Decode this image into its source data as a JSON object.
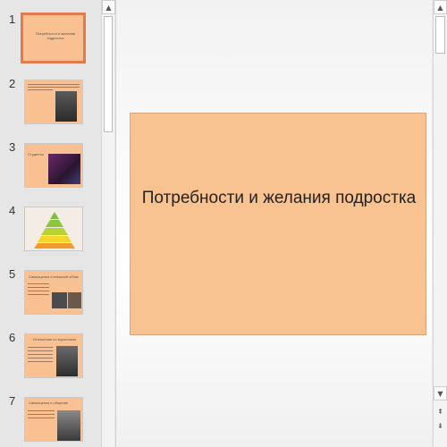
{
  "thumbnails": [
    {
      "num": "1",
      "title": "Потребности и желания подростка"
    },
    {
      "num": "2"
    },
    {
      "num": "3",
      "title": "Студенты"
    },
    {
      "num": "4"
    },
    {
      "num": "5",
      "title": "Самооценка и внешний облик"
    },
    {
      "num": "6",
      "title": "Отношения со взрослыми"
    },
    {
      "num": "7",
      "title": "Самооценка и общение"
    }
  ],
  "slide": {
    "title": "Потребности и желания подростка"
  },
  "scrollbar": {
    "up_icon": "▲",
    "down_icon": "▼",
    "prev_slide_icon": "⇞",
    "next_slide_icon": "⇟"
  },
  "colors": {
    "slide_bg": "#f9c291",
    "selected_border": "#e27b4c"
  }
}
